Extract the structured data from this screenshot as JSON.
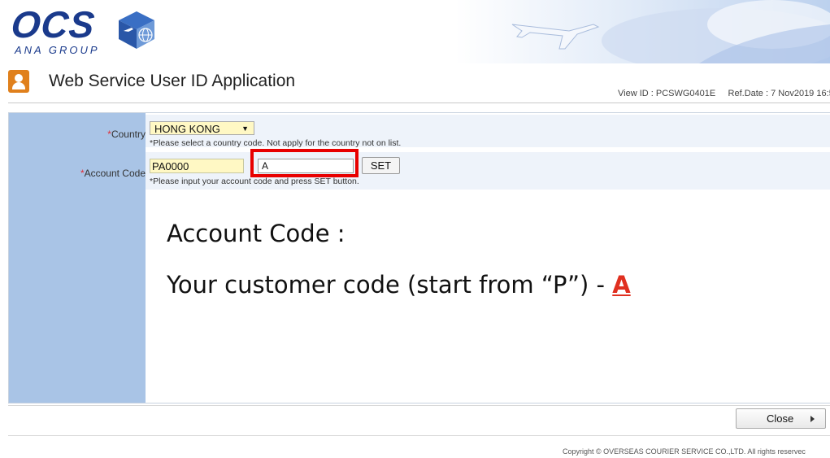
{
  "header": {
    "logo_text": "OCS",
    "logo_sub": "ANA GROUP"
  },
  "title_bar": {
    "title": "Web Service User ID Application",
    "view_id": "View ID : PCSWG0401E",
    "ref_date": "Ref.Date : 7 Nov2019 16:5"
  },
  "form": {
    "country": {
      "required_mark": "*",
      "label": "Country",
      "selected": "HONG KONG",
      "hint": "*Please select a country code. Not apply for the country not on list."
    },
    "account_code": {
      "required_mark": "*",
      "label": "Account Code",
      "prefix_value": "PA0000",
      "input_value": "A",
      "set_label": "SET",
      "hint": "*Please input your account code and press SET button."
    }
  },
  "annotation": {
    "title": "Account Code :",
    "line": "Your customer code (start from “P”) - ",
    "accent": "A",
    "accent_color": "#e03020",
    "highlight_color": "#e80000"
  },
  "footer": {
    "close_label": "Close",
    "copyright": "Copyright © OVERSEAS COURIER SERVICE CO.,LTD. All rights reservec"
  }
}
